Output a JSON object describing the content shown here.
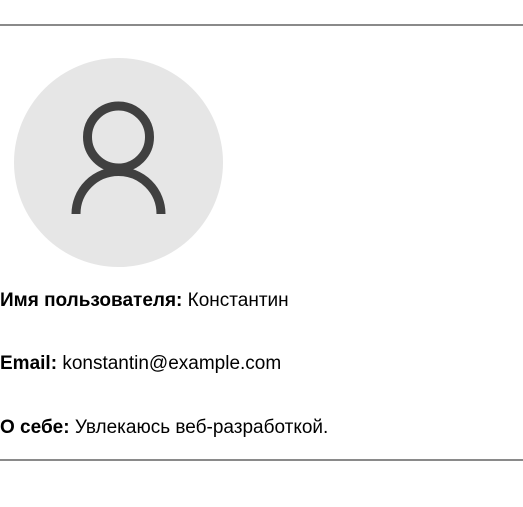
{
  "profile": {
    "avatar_icon": "user-icon",
    "avatar_bg": "#e6e6e6",
    "icon_color": "#404040",
    "fields": {
      "username": {
        "label": "Имя пользователя:",
        "value": "Константин"
      },
      "email": {
        "label": "Email:",
        "value": "konstantin@example.com"
      },
      "about": {
        "label": "О себе:",
        "value": "Увлекаюсь веб-разработкой."
      }
    }
  }
}
